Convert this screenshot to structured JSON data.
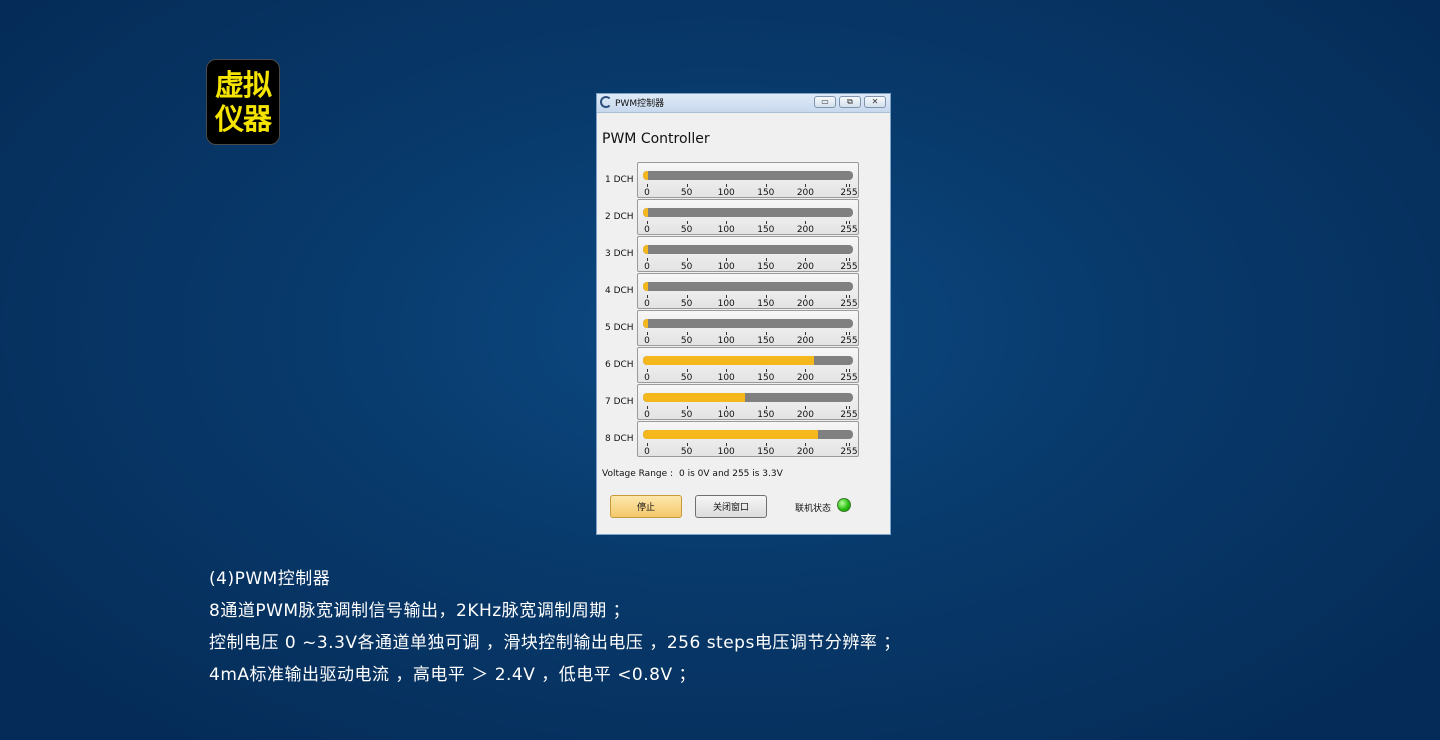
{
  "badge": {
    "line1": "虚拟",
    "line2": "仪器"
  },
  "window": {
    "title": "PWM控制器",
    "minimize": "▭",
    "restore": "⧉",
    "close": "✕",
    "app_title": "PWM Controller",
    "channels": [
      {
        "label": "1 DCH",
        "value": 3
      },
      {
        "label": "2 DCH",
        "value": 3
      },
      {
        "label": "3 DCH",
        "value": 3
      },
      {
        "label": "4 DCH",
        "value": 3
      },
      {
        "label": "5 DCH",
        "value": 3
      },
      {
        "label": "6 DCH",
        "value": 208
      },
      {
        "label": "7 DCH",
        "value": 124
      },
      {
        "label": "8 DCH",
        "value": 212
      }
    ],
    "scale": {
      "min": 0,
      "max": 255,
      "ticks": [
        0,
        50,
        100,
        150,
        200,
        255
      ]
    },
    "voltage_range_label": "Voltage Range :",
    "voltage_range_text": "0 is 0V and 255 is 3.3V",
    "stop_button": "停止",
    "close_window_button": "关闭窗口",
    "status_label": "联机状态",
    "status_color": "#29c012",
    "fill_color": "#f4b81c",
    "track_color": "#808080"
  },
  "description": {
    "line1": "(4)PWM控制器",
    "line2": "8通道PWM脉宽调制信号输出，2KHz脉宽调制周期 ；",
    "line3": "控制电压 0 ~3.3V各通道单独可调 ，滑块控制输出电压 ，256 steps电压调节分辨率 ；",
    "line4": "4mA标准输出驱动电流 ，高电平 ＞ 2.4V ，低电平 <0.8V ；"
  }
}
